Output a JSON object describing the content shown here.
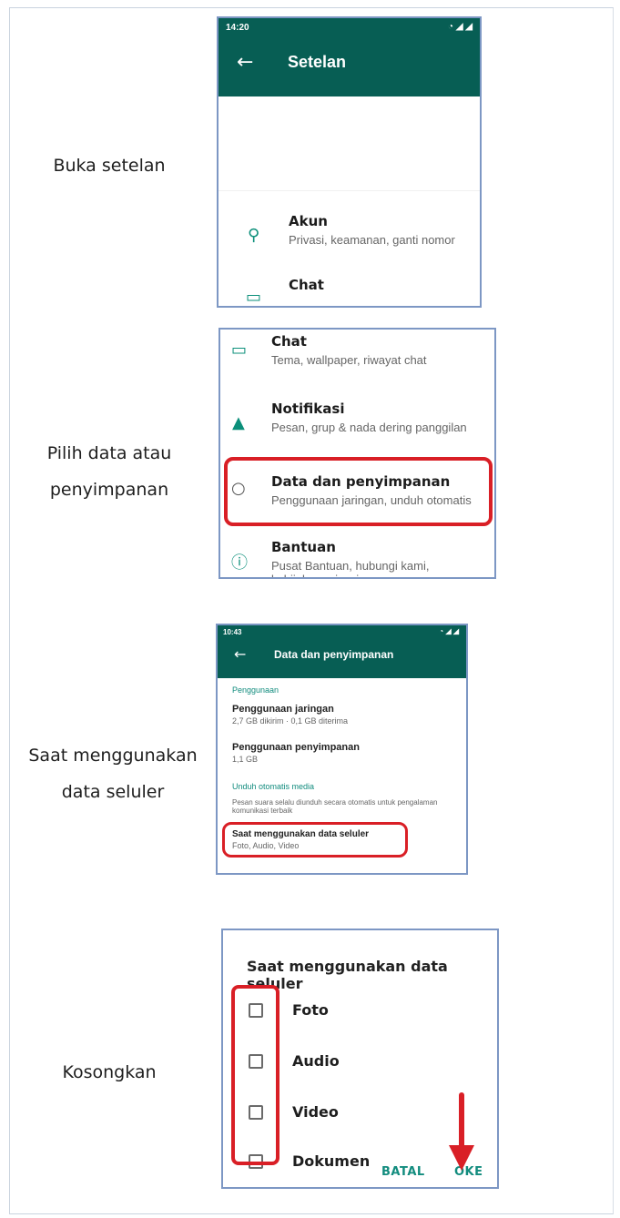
{
  "steps": [
    {
      "label_lines": [
        "Buka setelan"
      ]
    },
    {
      "label_lines": [
        "Pilih data atau",
        "penyimpanan"
      ]
    },
    {
      "label_lines": [
        "Saat menggunakan",
        "data seluler"
      ]
    },
    {
      "label_lines": [
        "Kosongkan"
      ]
    }
  ],
  "screen1": {
    "time": "14:20",
    "title": "Setelan",
    "rows": [
      {
        "icon": "key-icon",
        "title": "Akun",
        "subtitle": "Privasi, keamanan, ganti nomor"
      },
      {
        "icon": "chat-icon",
        "title": "Chat"
      }
    ]
  },
  "screen2": {
    "rows": [
      {
        "icon": "chat-icon",
        "title": "Chat",
        "subtitle": "Tema, wallpaper, riwayat chat"
      },
      {
        "icon": "bell-icon",
        "title": "Notifikasi",
        "subtitle": "Pesan, grup & nada dering panggilan"
      },
      {
        "icon": "data-usage-icon",
        "title": "Data dan penyimpanan",
        "subtitle": "Penggunaan jaringan, unduh otomatis"
      },
      {
        "icon": "help-icon",
        "title": "Bantuan",
        "subtitle": "Pusat Bantuan, hubungi kami, kebijakan privasi"
      }
    ]
  },
  "screen3": {
    "time": "10:43",
    "title": "Data dan penyimpanan",
    "section_usage": "Penggunaan",
    "network_title": "Penggunaan jaringan",
    "network_sub": "2,7 GB dikirim · 0,1 GB diterima",
    "storage_title": "Penggunaan penyimpanan",
    "storage_sub": "1,1 GB",
    "section_auto": "Unduh otomatis media",
    "auto_note": "Pesan suara selalu diunduh secara otomatis untuk pengalaman komunikasi terbaik",
    "mobile_title": "Saat menggunakan data seluler",
    "mobile_sub": "Foto, Audio, Video"
  },
  "screen4": {
    "title": "Saat menggunakan data seluler",
    "options": [
      {
        "label": "Foto",
        "checked": false
      },
      {
        "label": "Audio",
        "checked": false
      },
      {
        "label": "Video",
        "checked": false
      },
      {
        "label": "Dokumen",
        "checked": false
      }
    ],
    "cancel_label": "BATAL",
    "ok_label": "OKE"
  },
  "colors": {
    "appbar": "#075e54",
    "accent": "#128c7e",
    "highlight": "#d91f26"
  }
}
